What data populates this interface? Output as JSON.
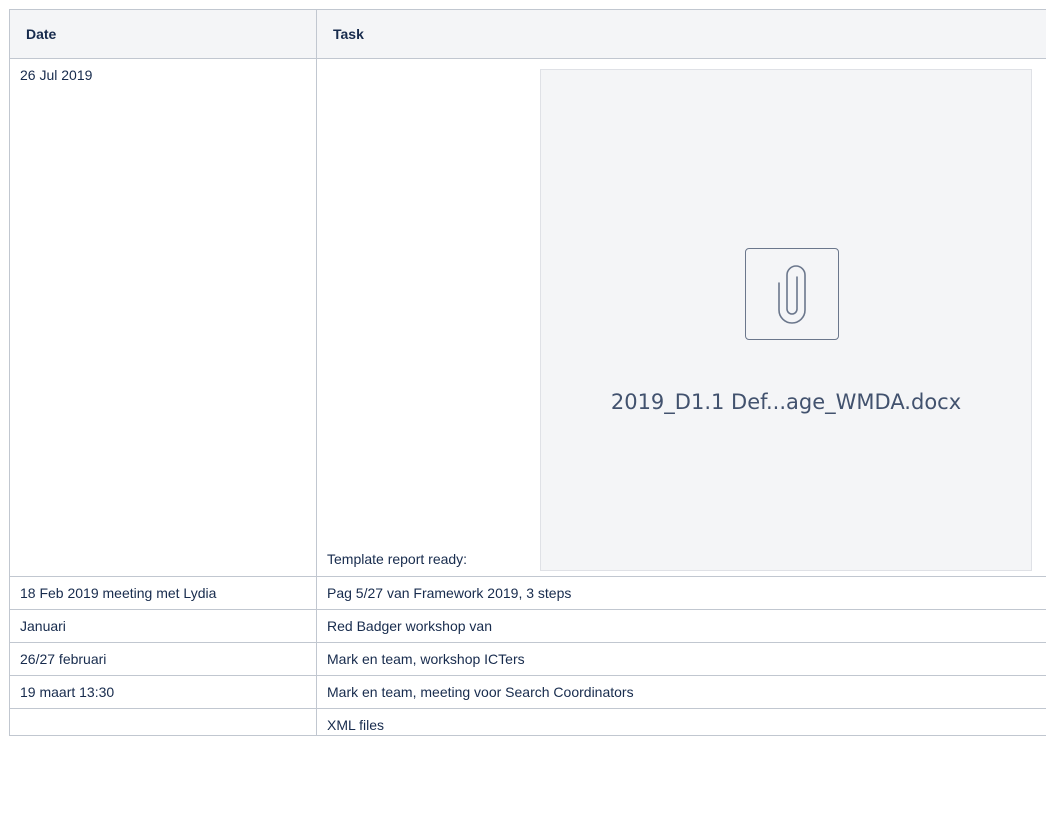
{
  "table": {
    "headers": [
      "Date",
      "Task"
    ],
    "rows": [
      {
        "date": "26 Jul 2019",
        "task": "Template report ready:"
      },
      {
        "date": "18 Feb 2019 meeting met Lydia",
        "task": "Pag 5/27 van Framework 2019, 3 steps"
      },
      {
        "date": "Januari",
        "task": "Red Badger workshop van"
      },
      {
        "date": "26/27 februari",
        "task": "Mark en team, workshop ICTers"
      },
      {
        "date": "19 maart 13:30",
        "task": "Mark en team, meeting voor Search Coordinators"
      },
      {
        "date": "",
        "task": "XML files"
      }
    ]
  },
  "attachment": {
    "filename": "2019_D1.1 Def...age_WMDA.docx",
    "icon": "paperclip-icon"
  }
}
